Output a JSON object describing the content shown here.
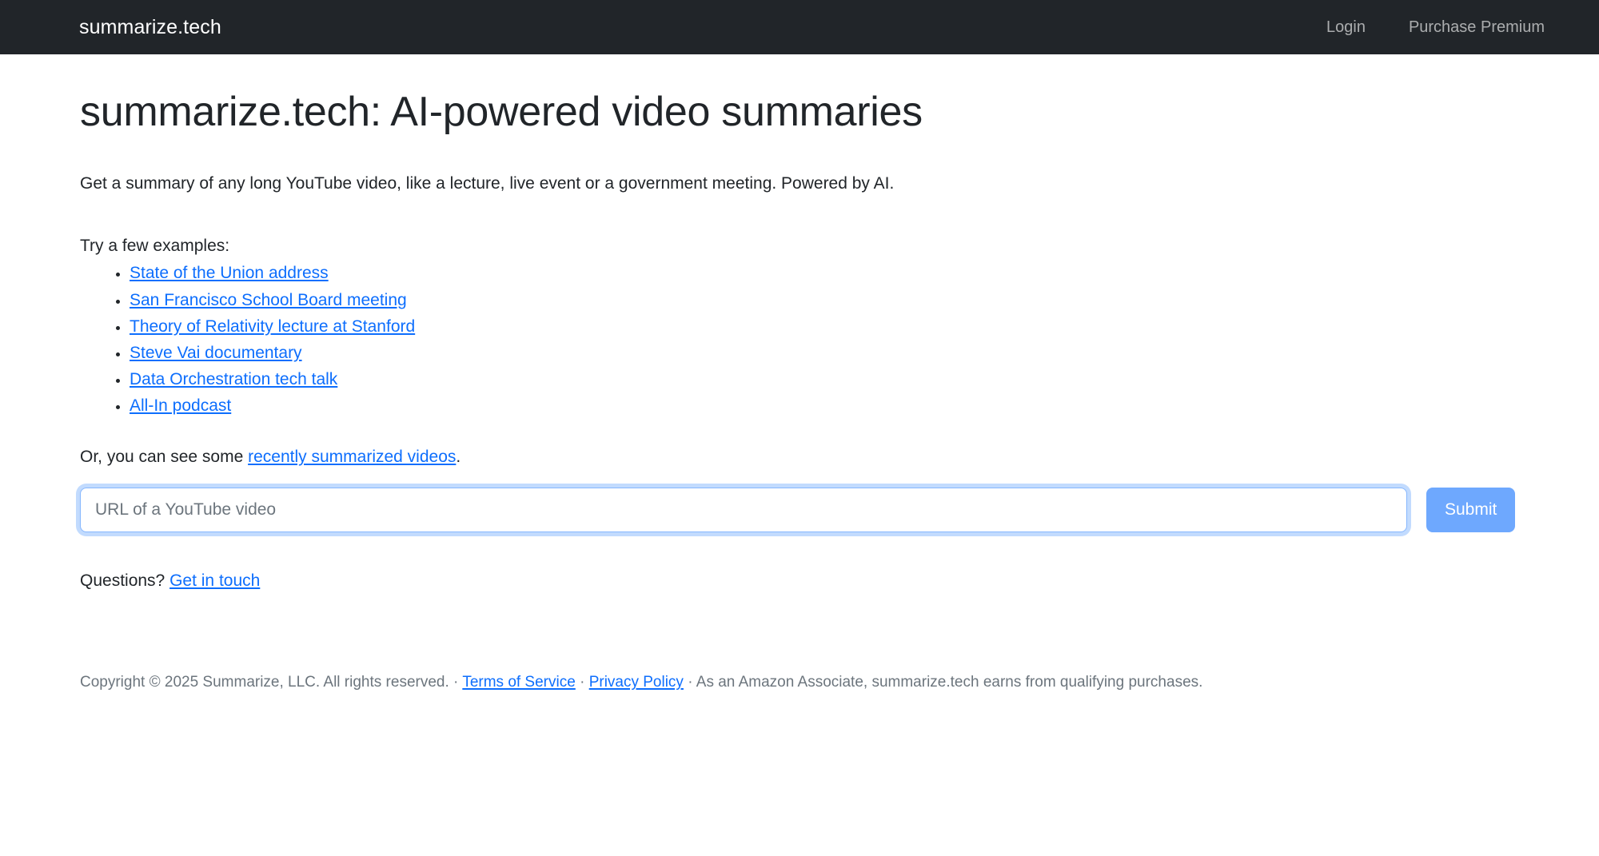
{
  "navbar": {
    "brand": "summarize.tech",
    "links": [
      {
        "label": "Login"
      },
      {
        "label": "Purchase Premium"
      }
    ]
  },
  "main": {
    "title": "summarize.tech: AI-powered video summaries",
    "lede": "Get a summary of any long YouTube video, like a lecture, live event or a government meeting. Powered by AI.",
    "try_label": "Try a few examples:",
    "examples": [
      {
        "label": "State of the Union address"
      },
      {
        "label": "San Francisco School Board meeting"
      },
      {
        "label": "Theory of Relativity lecture at Stanford"
      },
      {
        "label": "Steve Vai documentary"
      },
      {
        "label": "Data Orchestration tech talk"
      },
      {
        "label": "All-In podcast"
      }
    ],
    "recent": {
      "prefix": "Or, you can see some ",
      "link": "recently summarized videos",
      "suffix": "."
    },
    "form": {
      "input_value": "",
      "input_placeholder": "URL of a YouTube video",
      "submit_label": "Submit"
    },
    "questions": {
      "prefix": "Questions? ",
      "link": "Get in touch"
    }
  },
  "footer": {
    "copyright": "Copyright © 2025 Summarize, LLC. All rights reserved.",
    "sep1": "·",
    "terms": "Terms of Service",
    "sep2": "·",
    "privacy": "Privacy Policy",
    "sep3": "·",
    "amazon": "As an Amazon Associate, summarize.tech earns from qualifying purchases."
  },
  "colors": {
    "navbar_bg": "#212529",
    "link_blue": "#0d6efd",
    "submit_blue": "#6ea8fe",
    "focus_ring": "#86b7fe",
    "muted_text": "#6c757d",
    "page_bg": "#ffffff"
  }
}
